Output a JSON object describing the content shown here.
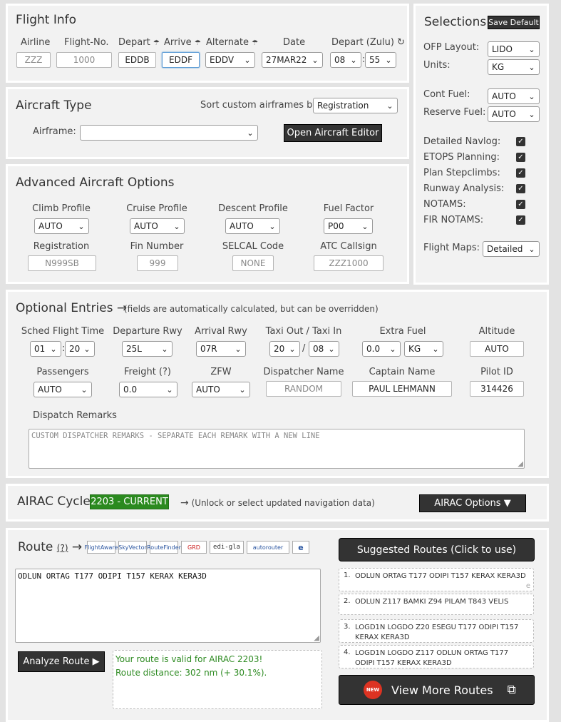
{
  "flight_info": {
    "title": "Flight Info",
    "airline_label": "Airline",
    "airline_placeholder": "ZZZ",
    "flightno_label": "Flight-No.",
    "flightno_placeholder": "1000",
    "depart_label": "Depart",
    "depart_value": "EDDB",
    "arrive_label": "Arrive",
    "arrive_value": "EDDF",
    "alternate_label": "Alternate",
    "alternate_value": "EDDV",
    "date_label": "Date",
    "date_value": "27MAR22",
    "deptime_label": "Depart (Zulu)",
    "hour_value": "08",
    "minute_value": "55",
    "colon": ":"
  },
  "selections": {
    "title": "Selections",
    "save_default": "Save Default",
    "ofp_layout_label": "OFP Layout:",
    "ofp_layout_value": "LIDO",
    "units_label": "Units:",
    "units_value": "KG",
    "cont_fuel_label": "Cont Fuel:",
    "cont_fuel_value": "AUTO",
    "reserve_fuel_label": "Reserve Fuel:",
    "reserve_fuel_value": "AUTO",
    "checkboxes": [
      "Detailed Navlog:",
      "ETOPS Planning:",
      "Plan Stepclimbs:",
      "Runway Analysis:",
      "NOTAMS:",
      "FIR NOTAMS:"
    ],
    "flight_maps_label": "Flight Maps:",
    "flight_maps_value": "Detailed"
  },
  "aircraft_type": {
    "title": "Aircraft Type",
    "sort_label": "Sort custom airframes by:",
    "sort_value": "Registration",
    "airframe_label": "Airframe:",
    "airframe_value": "",
    "editor_button": "Open Aircraft Editor"
  },
  "advanced": {
    "title": "Advanced Aircraft Options",
    "climb_label": "Climb Profile",
    "climb_value": "AUTO",
    "cruise_label": "Cruise Profile",
    "cruise_value": "AUTO",
    "descent_label": "Descent Profile",
    "descent_value": "AUTO",
    "fuel_factor_label": "Fuel Factor",
    "fuel_factor_value": "P00",
    "registration_label": "Registration",
    "registration_placeholder": "N999SB",
    "fin_label": "Fin Number",
    "fin_placeholder": "999",
    "selcal_label": "SELCAL Code",
    "selcal_placeholder": "NONE",
    "atc_label": "ATC Callsign",
    "atc_placeholder": "ZZZ1000"
  },
  "optional": {
    "title": "Optional Entries",
    "note": "(fields are automatically calculated, but can be overridden)",
    "sched_label": "Sched Flight Time",
    "sched_h": "01",
    "sched_m": "20",
    "colon": ":",
    "dep_rwy_label": "Departure Rwy",
    "dep_rwy_value": "25L",
    "arr_rwy_label": "Arrival Rwy",
    "arr_rwy_value": "07R",
    "taxi_label": "Taxi Out / Taxi In",
    "taxi_out": "20",
    "taxi_in": "08",
    "slash": "/",
    "extra_fuel_label": "Extra Fuel",
    "extra_fuel_value": "0.0",
    "extra_fuel_unit": "KG",
    "altitude_label": "Altitude",
    "altitude_value": "AUTO",
    "pax_label": "Passengers",
    "pax_value": "AUTO",
    "freight_label": "Freight (?)",
    "freight_value": "0.0",
    "zfw_label": "ZFW",
    "zfw_value": "AUTO",
    "dispatcher_label": "Dispatcher Name",
    "dispatcher_placeholder": "RANDOM",
    "captain_label": "Captain Name",
    "captain_value": "PAUL LEHMANN",
    "pilot_label": "Pilot ID",
    "pilot_value": "314426",
    "remarks_label": "Dispatch Remarks",
    "remarks_placeholder": "CUSTOM DISPATCHER REMARKS - SEPARATE EACH REMARK WITH A NEW LINE"
  },
  "airac": {
    "title": "AIRAC Cycle",
    "badge": "2203 - CURRENT",
    "note": "(Unlock or select updated navigation data)",
    "options_button": "AIRAC Options ▼"
  },
  "route": {
    "title": "Route",
    "help": "(?)",
    "logos": [
      "FlightAware",
      "SkyVector",
      "RouteFinder",
      "GRD",
      "edi-gla",
      "autorouter",
      "e"
    ],
    "value": "ODLUN ORTAG T177 ODIPI T157 KERAX KERA3D",
    "analyze_button": "Analyze Route ▶",
    "valid_line1": "Your route is valid for AIRAC 2203!",
    "valid_line2": "Route distance: 302 nm (+ 30.1%).",
    "suggested_title": "Suggested Routes (Click to use)",
    "suggested": [
      {
        "n": "1.",
        "text": "ODLUN ORTAG T177 ODIPI T157 KERAX KERA3D"
      },
      {
        "n": "2.",
        "text": "ODLUN Z117 BAMKI Z94 PILAM T843 VELIS"
      },
      {
        "n": "3.",
        "text": "LOGD1N LOGDO Z20 ESEGU T177 ODIPI T157 KERAX KERA3D"
      },
      {
        "n": "4.",
        "text": "LOGD1N LOGDO Z117 ODLUN ORTAG T177 ODIPI T157 KERAX KERA3D"
      }
    ],
    "new_badge": "NEW",
    "view_more": "View More Routes"
  },
  "colors": {
    "accent_green": "#2e8b22",
    "badge_green": "#2b8a1f",
    "dark_button": "#333333"
  }
}
